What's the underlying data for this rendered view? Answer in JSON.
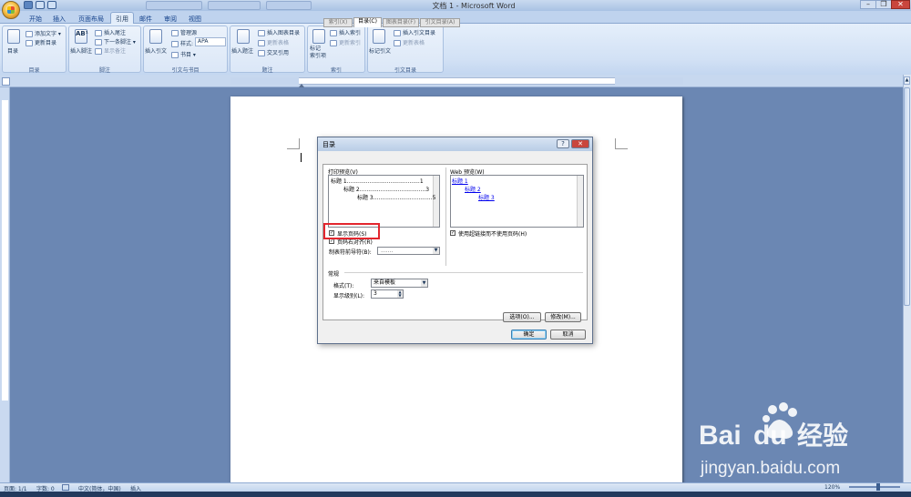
{
  "window": {
    "title": "文档 1 - Microsoft Word",
    "close": "✕",
    "restore": "❐",
    "minimize": "–"
  },
  "ribbon_tabs": [
    "开始",
    "插入",
    "页面布局",
    "引用",
    "邮件",
    "审阅",
    "视图"
  ],
  "active_tab": "引用",
  "ribbon": {
    "toc": {
      "big": "目录",
      "add_text": "添加文字 ▾",
      "update": "更新目录",
      "label": "目录"
    },
    "footnotes": {
      "insert_footnote": "插入脚注",
      "insert_endnote": "插入尾注",
      "next_footnote": "下一条脚注 ▾",
      "show_notes": "显示备注",
      "label": "脚注"
    },
    "citations": {
      "insert_citation": "插入引文",
      "manage_sources": "管理源",
      "style_label": "样式:",
      "style_value": "APA",
      "bibliography": "书目 ▾",
      "label": "引文与书目"
    },
    "captions": {
      "insert_caption": "插入题注",
      "insert_table_of_figures": "插入图表目录",
      "update_table": "更新表格",
      "cross_reference": "交叉引用",
      "label": "题注"
    },
    "index": {
      "mark_entry": "标记\n索引项",
      "insert_index": "插入索引",
      "update_index": "更新索引",
      "label": "索引"
    },
    "authorities": {
      "mark_citation": "标记引文",
      "insert_toa": "插入引文目录",
      "update_table": "更新表格",
      "label": "引文目录"
    }
  },
  "dialog": {
    "title": "目录",
    "help": "?",
    "close": "✕",
    "tabs": [
      "索引(X)",
      "目录(C)",
      "图表目录(F)",
      "引文目录(A)"
    ],
    "print_preview_label": "打印预览(V)",
    "print_preview_lines": [
      "标题 1..........................................1",
      "标题 2......................................3",
      "标题 3..................................5"
    ],
    "web_preview_label": "Web 预览(W)",
    "web_preview_links": [
      "标题 1",
      "标题 2",
      "标题 3"
    ],
    "show_page_numbers": "显示页码(S)",
    "right_align": "页码右对齐(R)",
    "tab_leader_label": "制表符前导符(B):",
    "tab_leader_value": ".......",
    "use_hyperlinks": "使用超链接而不使用页码(H)",
    "general_label": "常规",
    "formats_label": "格式(T):",
    "formats_value": "来自模板",
    "levels_label": "显示级别(L):",
    "levels_value": "3",
    "options_button": "选项(O)...",
    "modify_button": "修改(M)...",
    "ok_button": "确定",
    "cancel_button": "取消"
  },
  "status": {
    "page": "页面: 1/1",
    "words": "字数: 0",
    "language": "中文(简体，中国)",
    "mode": "插入",
    "zoom": "120%"
  },
  "watermark": {
    "brand": "Bai du 经验",
    "url": "jingyan.baidu.com"
  }
}
